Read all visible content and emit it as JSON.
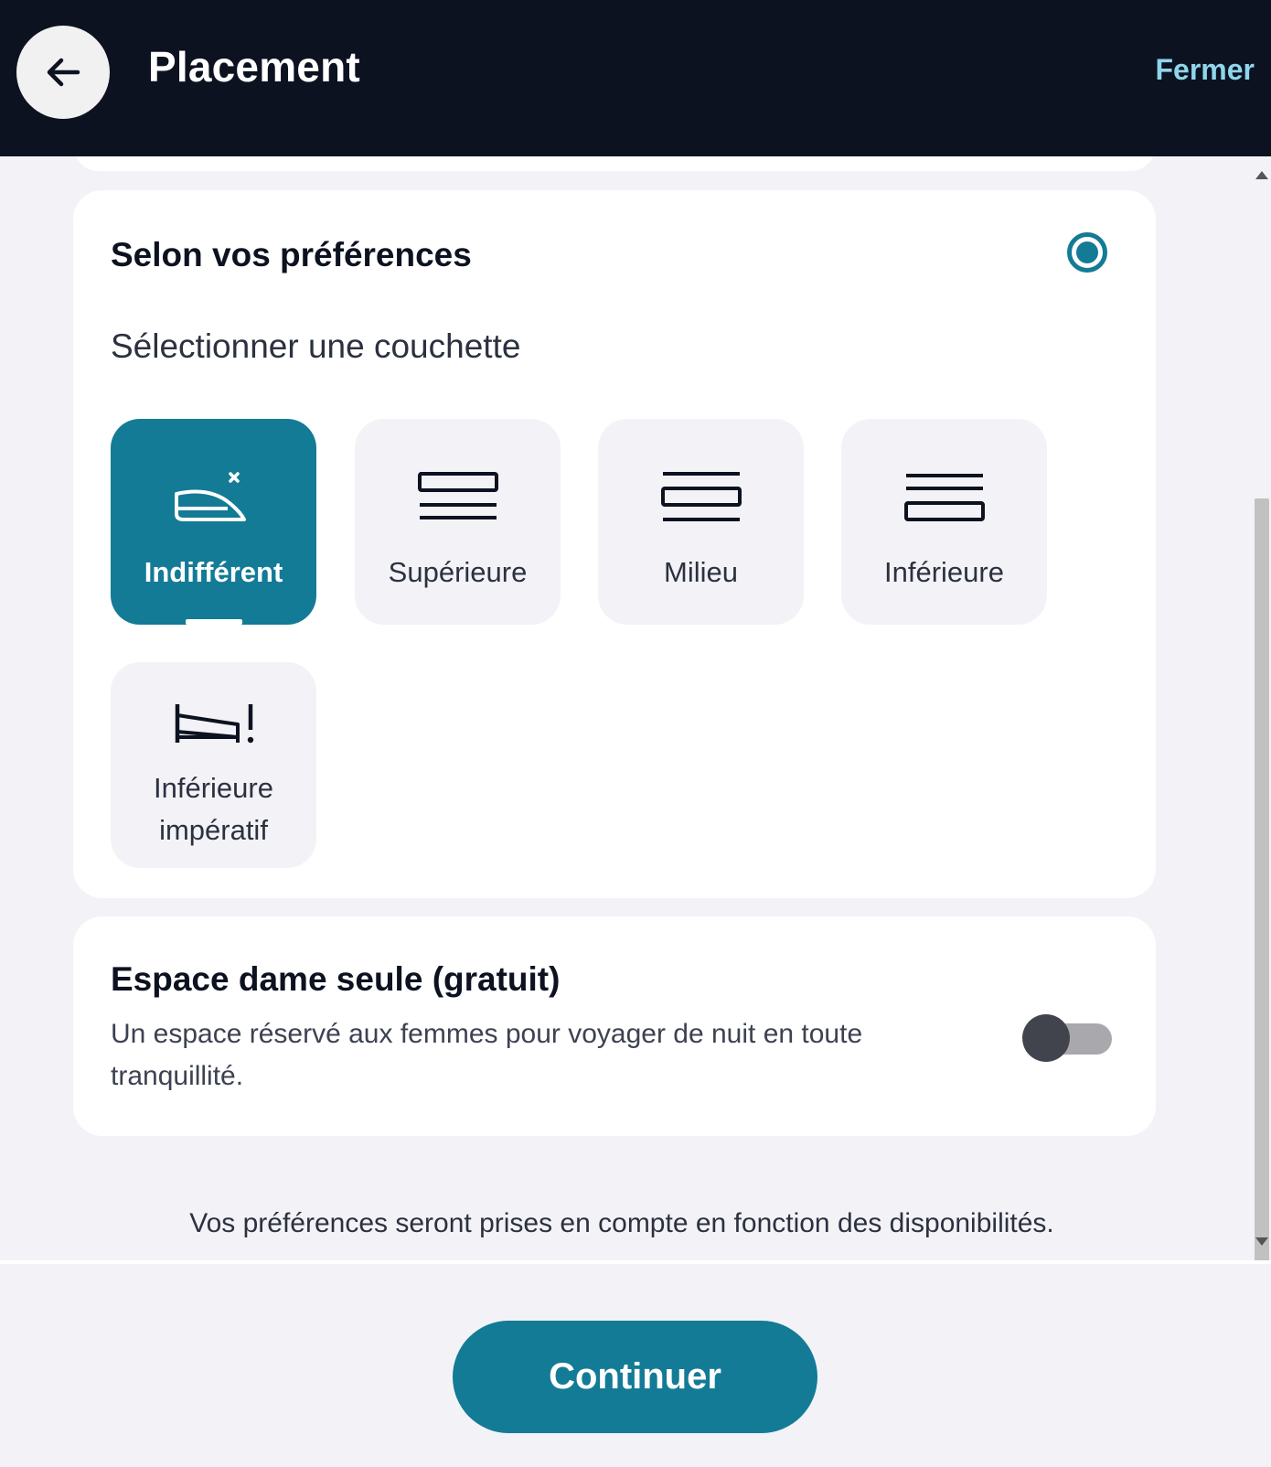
{
  "header": {
    "title": "Placement",
    "close_label": "Fermer",
    "back_icon": "arrow-left-icon"
  },
  "preferences": {
    "title": "Selon vos préférences",
    "radio_selected": true,
    "select_label": "Sélectionner une couchette",
    "options": [
      {
        "label": "Indifférent",
        "icon": "no-preference-icon",
        "selected": true
      },
      {
        "label": "Supérieure",
        "icon": "upper-berth-icon",
        "selected": false
      },
      {
        "label": "Milieu",
        "icon": "middle-berth-icon",
        "selected": false
      },
      {
        "label": "Inférieure",
        "icon": "lower-berth-icon",
        "selected": false
      },
      {
        "label_line1": "Inférieure",
        "label_line2": "impératif",
        "icon": "lower-berth-mandatory-icon",
        "selected": false
      }
    ]
  },
  "dame": {
    "title": "Espace dame seule (gratuit)",
    "description": "Un espace réservé aux femmes pour voyager de nuit en toute tranquillité.",
    "toggle_on": false
  },
  "note": "Vos préférences seront prises en compte en fonction des disponibilités.",
  "footer": {
    "continue_label": "Continuer"
  },
  "colors": {
    "header_bg": "#0c1220",
    "accent": "#137b96",
    "close_link": "#8fd6ec",
    "page_bg": "#f3f3f7"
  }
}
